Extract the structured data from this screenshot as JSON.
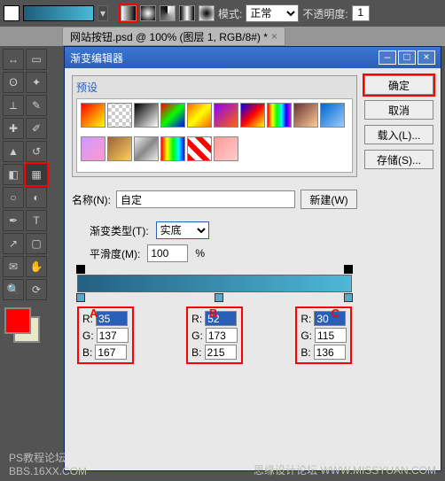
{
  "topbar": {
    "mode_label": "模式:",
    "mode_value": "正常",
    "opacity_label": "不透明度:",
    "opacity_value": "1"
  },
  "tab": {
    "name": "网站按钮.psd @ 100% (图层 1, RGB/8#) *"
  },
  "dialog": {
    "title": "渐变编辑器",
    "presets_label": "预设",
    "buttons": {
      "ok": "确定",
      "cancel": "取消",
      "load": "载入(L)...",
      "save": "存储(S)...",
      "new": "新建(W)"
    },
    "name_label": "名称(N):",
    "name_value": "自定",
    "type_label": "渐变类型(T):",
    "type_value": "实底",
    "smooth_label": "平滑度(M):",
    "smooth_value": "100",
    "smooth_pct": "%",
    "markers": {
      "a": "A",
      "b": "B",
      "c": "C"
    },
    "rgb": {
      "a": {
        "r_label": "R:",
        "r": "35",
        "g_label": "G:",
        "g": "137",
        "b_label": "B:",
        "b": "167"
      },
      "b": {
        "r_label": "R:",
        "r": "52",
        "g_label": "G:",
        "g": "173",
        "b_label": "B:",
        "b": "215"
      },
      "c": {
        "r_label": "R:",
        "r": "30",
        "g_label": "G:",
        "g": "115",
        "b_label": "B:",
        "b": "136"
      }
    }
  },
  "watermark": {
    "left": "PS教程论坛",
    "bottom": "BBS.16XX.COM",
    "right": "思缘设计论坛  WWW.MISSYUAN.COM"
  }
}
